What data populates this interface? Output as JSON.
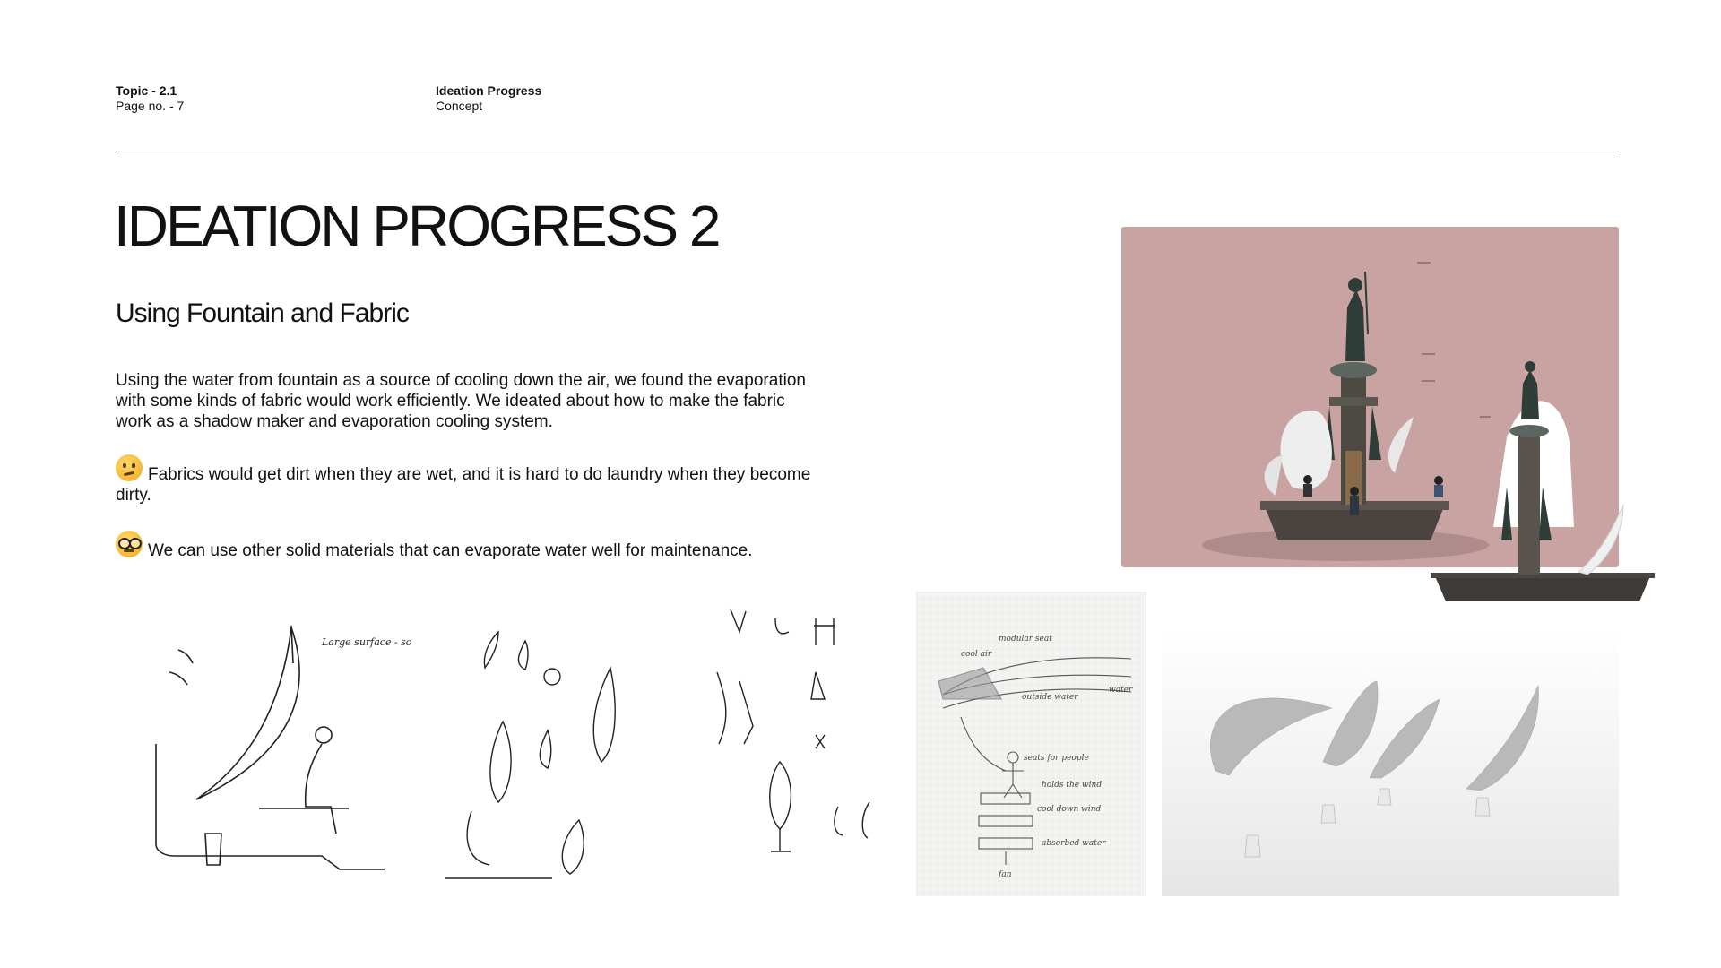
{
  "header": {
    "topic": "Topic - 2.1",
    "page": "Page no. - 7",
    "section_title": "Ideation Progress",
    "section_sub": "Concept"
  },
  "main": {
    "title": "IDEATION PROGRESS 2",
    "subtitle": "Using Fountain and Fabric",
    "intro": "Using the water from fountain as a source of cooling down the air, we found the evaporation with some kinds of fabric would work efficiently. We ideated about how to make the fabric work as a shadow maker and evaporation cooling system.",
    "note_problem": "Fabrics would get dirt when they are wet, and it is hard to do laundry when they become dirty.",
    "note_solution": "We can use other solid materials that can evaporate water well for maintenance."
  },
  "icons": {
    "problem": "thinking-face-emoji",
    "solution": "nerd-face-emoji"
  },
  "colors": {
    "fountain_bg": "#c9a2a2",
    "rule": "#333333"
  },
  "sketches": {
    "s1_note": "Large surface - soaking potential Exposure to wind",
    "s4_note_a": "cool air",
    "s4_note_b": "modular seat",
    "s4_note_c": "water",
    "s4_note_d": "outside water",
    "s4_note_e": "seats for people",
    "s4_note_f": "holds the wind",
    "s4_note_g": "cool down wind",
    "s4_note_h": "absorbed water",
    "s4_note_i": "fan"
  }
}
